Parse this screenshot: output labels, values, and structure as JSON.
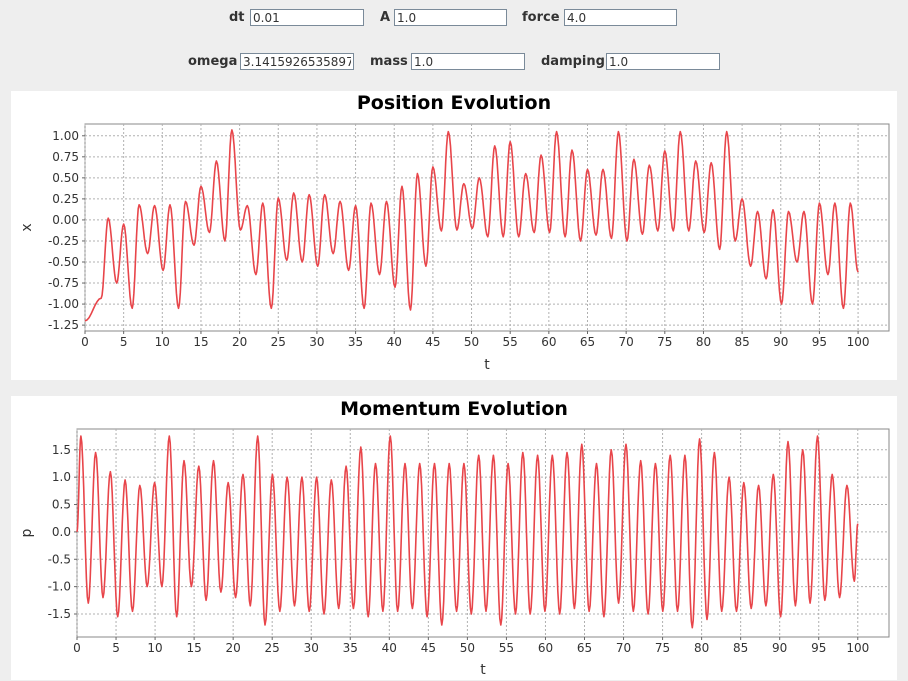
{
  "controls": {
    "dt": {
      "label": "dt",
      "value": "0.01"
    },
    "A": {
      "label": "A",
      "value": "1.0"
    },
    "force": {
      "label": "force",
      "value": "4.0"
    },
    "omega": {
      "label": "omega",
      "value": "3.141592653589793"
    },
    "mass": {
      "label": "mass",
      "value": "1.0"
    },
    "damping": {
      "label": "damping",
      "value": "1.0"
    }
  },
  "colors": {
    "series": "#e8454a",
    "grid": "#b0b0b0",
    "background": "#eeeeee"
  },
  "chart_data": [
    {
      "type": "line",
      "title": "Position Evolution",
      "xlabel": "t",
      "ylabel": "x",
      "xlim": [
        0,
        104
      ],
      "ylim": [
        -1.32,
        1.14
      ],
      "xticks": [
        0,
        5,
        10,
        15,
        20,
        25,
        30,
        35,
        40,
        45,
        50,
        55,
        60,
        65,
        70,
        75,
        80,
        85,
        90,
        95,
        100
      ],
      "yticks": [
        -1.25,
        -1.0,
        -0.75,
        -0.5,
        -0.25,
        0.0,
        0.25,
        0.5,
        0.75,
        1.0
      ],
      "ytick_labels": [
        "-1.25",
        "-1.00",
        "-0.75",
        "-0.50",
        "-0.25",
        "0.00",
        "0.25",
        "0.50",
        "0.75",
        "1.00"
      ],
      "grid": true,
      "series": [
        {
          "t_range": [
            0,
            100
          ],
          "peak_period": 2.0,
          "peak_t": [
            3.0,
            5.0,
            7.0,
            9.0,
            11.0,
            13.0,
            15.0,
            17.0,
            19.0,
            21.0,
            23.0,
            25.0,
            27.0,
            29.0,
            31.0,
            33.0,
            35.0,
            37.0,
            39.0,
            41.0,
            43.0,
            45.0,
            47.0,
            49.0,
            51.0,
            53.0,
            55.0,
            57.0,
            59.0,
            61.0,
            63.0,
            65.0,
            67.0,
            69.0,
            71.0,
            73.0,
            75.0,
            77.0,
            79.0,
            81.0,
            83.0,
            85.0,
            87.0,
            89.0,
            91.0,
            93.0,
            95.0,
            97.0,
            99.0
          ],
          "trough_t": [
            1.0,
            2.0,
            4.0,
            6.0,
            8.0,
            10.0,
            12.0,
            14.0,
            16.0,
            18.0,
            20.0,
            22.0,
            24.0,
            26.0,
            28.0,
            30.0,
            32.0,
            34.0,
            36.0,
            38.0,
            40.0,
            42.0,
            44.0,
            46.0,
            48.0,
            50.0,
            52.0,
            54.0,
            56.0,
            58.0,
            60.0,
            62.0,
            64.0,
            66.0,
            68.0,
            70.0,
            72.0,
            74.0,
            76.0,
            78.0,
            80.0,
            82.0,
            84.0,
            86.0,
            88.0,
            90.0,
            92.0,
            94.0,
            96.0,
            98.0,
            100.0
          ],
          "peaks": [
            0.02,
            -0.05,
            0.18,
            0.17,
            0.18,
            0.22,
            0.4,
            0.7,
            1.07,
            0.17,
            0.2,
            0.26,
            0.32,
            0.3,
            0.3,
            0.22,
            0.17,
            0.2,
            0.22,
            0.4,
            0.55,
            0.63,
            1.05,
            0.43,
            0.5,
            0.88,
            0.93,
            0.55,
            0.77,
            1.05,
            0.83,
            0.6,
            0.6,
            1.05,
            0.72,
            0.65,
            0.82,
            1.05,
            0.7,
            0.68,
            1.05,
            0.25,
            0.1,
            0.12,
            0.1,
            0.1,
            0.2,
            0.2,
            0.2
          ],
          "troughs": [
            -1.2,
            -0.93,
            -0.75,
            -1.05,
            -0.4,
            -0.6,
            -1.05,
            -0.3,
            -0.15,
            -0.25,
            -0.12,
            -0.65,
            -1.05,
            -0.48,
            -0.5,
            -0.55,
            -0.4,
            -0.6,
            -1.05,
            -0.65,
            -0.8,
            -1.07,
            -0.55,
            -0.13,
            -0.12,
            -0.1,
            -0.2,
            -0.2,
            -0.2,
            -0.15,
            -0.15,
            -0.2,
            -0.25,
            -0.18,
            -0.22,
            -0.25,
            -0.17,
            -0.13,
            -0.13,
            -0.13,
            -0.15,
            -0.35,
            -0.25,
            -0.55,
            -0.7,
            -1.0,
            -0.5,
            -1.0,
            -0.65,
            -1.05,
            -0.5,
            -0.62
          ]
        }
      ]
    },
    {
      "type": "line",
      "title": "Momentum Evolution",
      "xlabel": "t",
      "ylabel": "p",
      "xlim": [
        0,
        104
      ],
      "ylim": [
        -1.92,
        1.88
      ],
      "xticks": [
        0,
        5,
        10,
        15,
        20,
        25,
        30,
        35,
        40,
        45,
        50,
        55,
        60,
        65,
        70,
        75,
        80,
        85,
        90,
        95,
        100
      ],
      "yticks": [
        -1.5,
        -1.0,
        -0.5,
        0.0,
        0.5,
        1.0,
        1.5
      ],
      "ytick_labels": [
        "-1.5",
        "-1.0",
        "-0.5",
        "0.0",
        "0.5",
        "1.0",
        "1.5"
      ],
      "grid": true,
      "series": [
        {
          "t_range": [
            0,
            100
          ],
          "period": 2.0,
          "peaks": [
            1.75,
            1.45,
            1.1,
            0.95,
            0.85,
            0.9,
            1.75,
            1.3,
            1.2,
            1.3,
            0.9,
            1.05,
            1.75,
            1.05,
            1.0,
            1.0,
            1.0,
            0.95,
            1.2,
            1.55,
            1.25,
            1.75,
            1.25,
            1.25,
            1.25,
            1.25,
            1.25,
            1.4,
            1.4,
            1.25,
            1.45,
            1.4,
            1.4,
            1.45,
            1.6,
            1.25,
            1.5,
            1.6,
            1.3,
            1.25,
            1.4,
            1.4,
            1.7,
            1.45,
            1.0,
            0.9,
            0.85,
            1.05,
            1.65,
            1.5,
            1.75,
            1.05,
            0.85
          ],
          "troughs": [
            -1.3,
            -1.2,
            -1.55,
            -1.45,
            -1.0,
            -1.0,
            -1.55,
            -1.0,
            -1.25,
            -1.1,
            -1.2,
            -1.35,
            -1.7,
            -1.45,
            -1.35,
            -1.45,
            -1.5,
            -1.4,
            -1.4,
            -1.55,
            -1.45,
            -1.45,
            -1.4,
            -1.55,
            -1.7,
            -1.45,
            -1.5,
            -1.45,
            -1.7,
            -1.5,
            -1.5,
            -1.45,
            -1.5,
            -1.4,
            -1.45,
            -1.55,
            -1.3,
            -1.45,
            -1.5,
            -1.45,
            -1.45,
            -1.75,
            -1.6,
            -1.45,
            -1.45,
            -1.4,
            -1.35,
            -1.55,
            -1.35,
            -1.3,
            -1.25,
            -1.2,
            -0.9
          ]
        }
      ]
    }
  ]
}
